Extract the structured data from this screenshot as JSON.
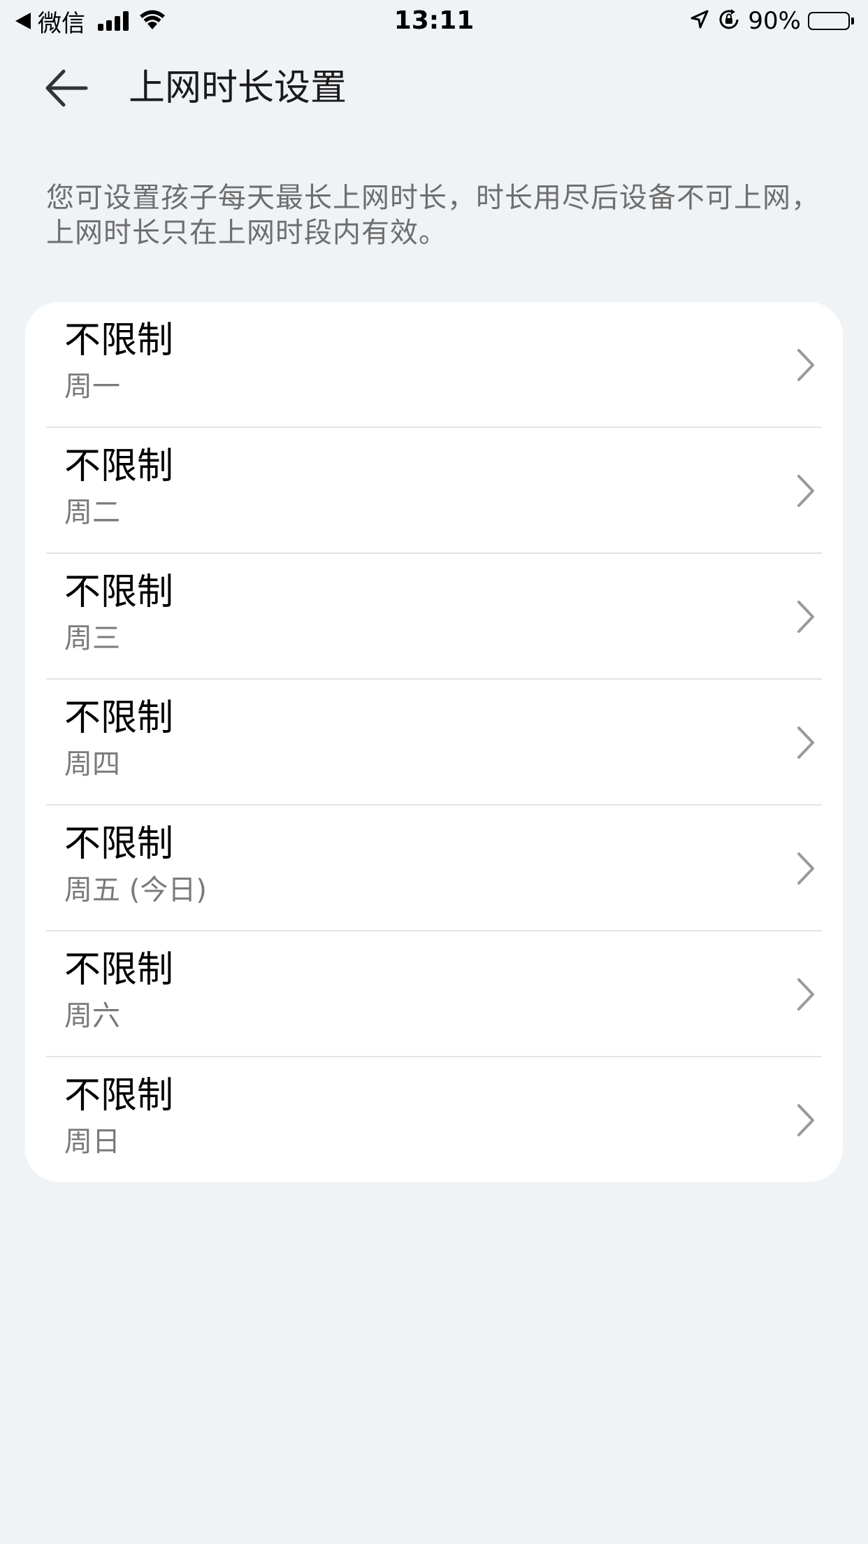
{
  "status_bar": {
    "back_app_label": "微信",
    "time": "13:11",
    "battery_percent": "90%",
    "battery_level": 0.9,
    "icons": [
      "back-triangle-icon",
      "cellular-signal-icon",
      "wifi-icon",
      "location-arrow-icon",
      "orientation-lock-icon",
      "battery-icon"
    ]
  },
  "header": {
    "back_icon": "arrow-left-icon",
    "title": "上网时长设置"
  },
  "description": "您可设置孩子每天最长上网时长，时长用尽后设备不可上网，上网时长只在上网时段内有效。",
  "schedule": {
    "items": [
      {
        "value": "不限制",
        "day": "周一"
      },
      {
        "value": "不限制",
        "day": "周二"
      },
      {
        "value": "不限制",
        "day": "周三"
      },
      {
        "value": "不限制",
        "day": "周四"
      },
      {
        "value": "不限制",
        "day": "周五 (今日)"
      },
      {
        "value": "不限制",
        "day": "周六"
      },
      {
        "value": "不限制",
        "day": "周日"
      }
    ],
    "chevron_icon": "chevron-right-icon"
  },
  "colors": {
    "background": "#f0f3f6",
    "card": "#ffffff",
    "secondary_text": "#7a7a7a",
    "description_text": "#6e6e6e",
    "divider": "#e3e3e3",
    "chevron": "#9a9a9a"
  }
}
